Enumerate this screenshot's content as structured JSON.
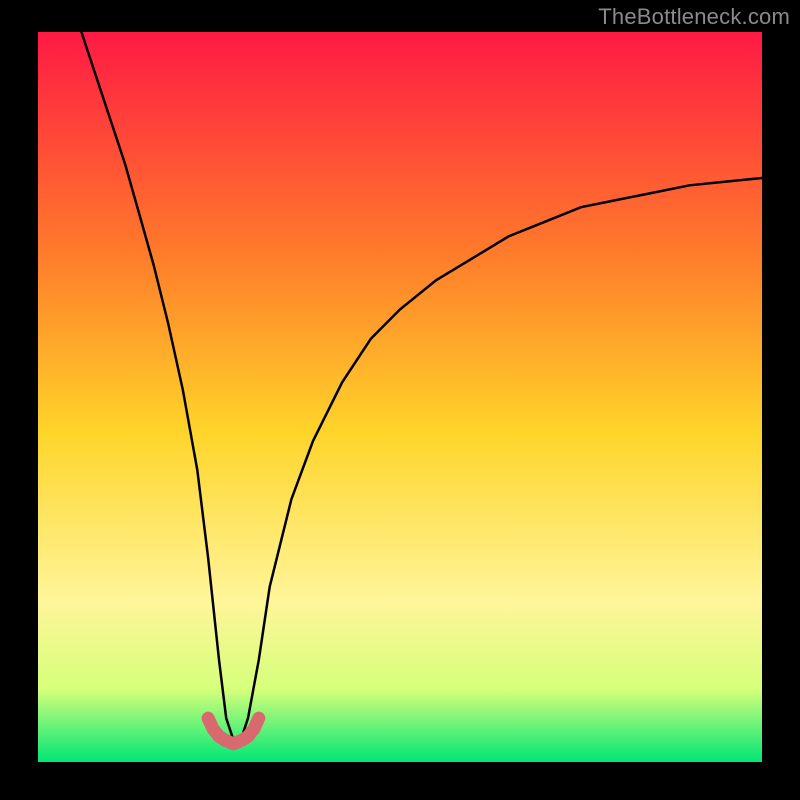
{
  "watermark": "TheBottleneck.com",
  "colors": {
    "gradient_top": "#ff1a44",
    "gradient_mid_upper": "#ff7a2b",
    "gradient_mid": "#ffd52a",
    "gradient_mid_lower": "#fff59a",
    "gradient_lower": "#d6ff7a",
    "gradient_bottom": "#00e676",
    "bg": "#000000",
    "curve": "#000000",
    "marker": "#d86a6f"
  },
  "chart_data": {
    "type": "line",
    "title": "",
    "xlabel": "",
    "ylabel": "",
    "xlim": [
      0,
      100
    ],
    "ylim": [
      0,
      100
    ],
    "x_min_point": 27,
    "curve_description": "Bottleneck severity curve; y≈100 (red) = severe bottleneck, y≈0 (green) = balanced. Steep drop from top-left to a minimum near x≈27, then rises with decreasing slope toward top-right, ending near y≈80 at x=100.",
    "series": [
      {
        "name": "bottleneck-severity",
        "x": [
          6,
          8,
          10,
          12,
          14,
          16,
          18,
          20,
          22,
          23.5,
          25,
          26,
          27,
          28,
          29,
          30.5,
          32,
          35,
          38,
          42,
          46,
          50,
          55,
          60,
          65,
          70,
          75,
          80,
          85,
          90,
          95,
          100
        ],
        "values": [
          100,
          94,
          88,
          82,
          75,
          68,
          60,
          51,
          40,
          28,
          14,
          6,
          3,
          3,
          6,
          14,
          24,
          36,
          44,
          52,
          58,
          62,
          66,
          69,
          72,
          74,
          76,
          77,
          78,
          79,
          79.5,
          80
        ]
      },
      {
        "name": "optimum-marker",
        "x": [
          23.5,
          24.2,
          25,
          25.8,
          26.5,
          27,
          27.5,
          28.2,
          29,
          29.8,
          30.5
        ],
        "values": [
          6,
          4.5,
          3.5,
          3,
          2.7,
          2.5,
          2.7,
          3,
          3.5,
          4.5,
          6
        ]
      }
    ]
  }
}
